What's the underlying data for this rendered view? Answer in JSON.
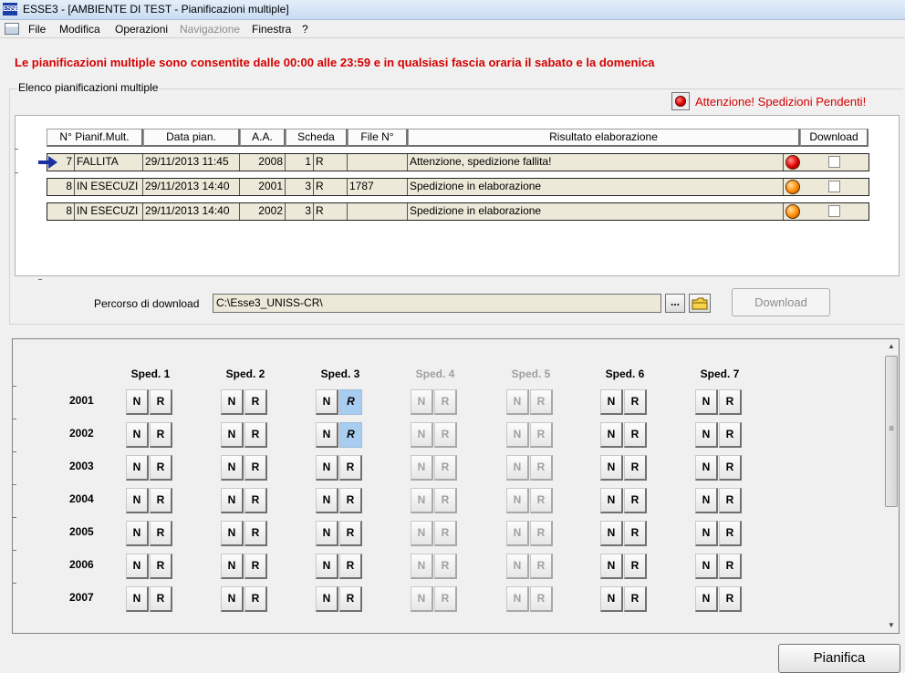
{
  "window": {
    "app_icon": "ESSE",
    "title": "ESSE3 - [AMBIENTE DI TEST - Pianificazioni multiple]"
  },
  "menu": [
    {
      "label": "File",
      "enabled": true
    },
    {
      "label": "Modifica",
      "enabled": true
    },
    {
      "label": "Operazioni",
      "enabled": true
    },
    {
      "label": "Navigazione",
      "enabled": false
    },
    {
      "label": "Finestra",
      "enabled": true
    },
    {
      "label": "?",
      "enabled": true
    }
  ],
  "warning": "Le pianificazioni multiple sono consentite dalle 00:00 alle 23:59 e in qualsiasi fascia oraria il sabato e la domenica",
  "group_title": "Elenco pianificazioni multiple",
  "alert": {
    "icon": "red-light-icon",
    "text": "Attenzione! Spedizioni Pendenti!"
  },
  "table": {
    "headers": [
      "N° Pianif.Mult.",
      "Data pian.",
      "A.A.",
      "Scheda",
      "File N°",
      "Risultato elaborazione",
      "Download"
    ],
    "rows": [
      {
        "n": "7",
        "stato": "FALLITA",
        "data": "29/11/2013 11:45",
        "aa": "2008",
        "num": "1",
        "scheda": "R",
        "file": "",
        "risultato": "Attenzione, spedizione fallita!",
        "status_color": "#e00000",
        "current": true,
        "download": false
      },
      {
        "n": "8",
        "stato": "IN ESECUZI",
        "data": "29/11/2013 14:40",
        "aa": "2001",
        "num": "3",
        "scheda": "R",
        "file": "1787",
        "risultato": "Spedizione in elaborazione",
        "status_color": "#ff8a00",
        "current": false,
        "download": false
      },
      {
        "n": "8",
        "stato": "IN ESECUZI",
        "data": "29/11/2013 14:40",
        "aa": "2002",
        "num": "3",
        "scheda": "R",
        "file": "",
        "risultato": "Spedizione in elaborazione",
        "status_color": "#ff8a00",
        "current": false,
        "download": false
      }
    ]
  },
  "download_path": {
    "label": "Percorso di download",
    "value": "C:\\Esse3_UNISS-CR\\",
    "browse_label": "...",
    "folder_icon": "folder-icon"
  },
  "download_button": "Download",
  "sped": {
    "columns": [
      {
        "label": "Sped. 1",
        "enabled": true
      },
      {
        "label": "Sped. 2",
        "enabled": true
      },
      {
        "label": "Sped. 3",
        "enabled": true
      },
      {
        "label": "Sped. 4",
        "enabled": false
      },
      {
        "label": "Sped. 5",
        "enabled": false
      },
      {
        "label": "Sped. 6",
        "enabled": true
      },
      {
        "label": "Sped. 7",
        "enabled": true
      }
    ],
    "years": [
      "2001",
      "2002",
      "2003",
      "2004",
      "2005",
      "2006",
      "2007"
    ],
    "button_labels": [
      "N",
      "R"
    ],
    "selected": [
      {
        "year": "2001",
        "sped": "Sped. 3",
        "button": "R"
      },
      {
        "year": "2002",
        "sped": "Sped. 3",
        "button": "R"
      }
    ]
  },
  "pianifica_button": "Pianifica"
}
